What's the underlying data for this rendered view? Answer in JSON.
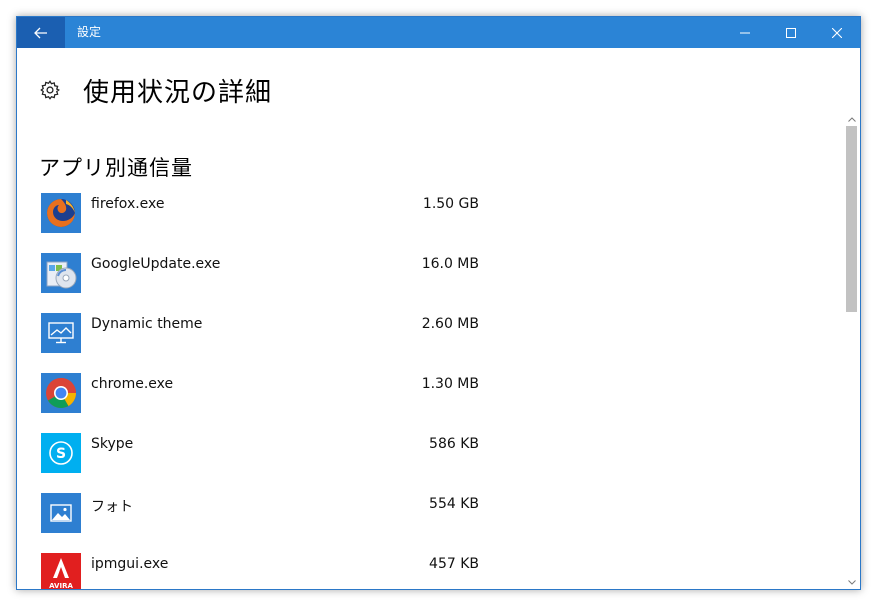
{
  "window": {
    "title": "設定",
    "accent": "#2b84d6",
    "back_button_color": "#1b5fb1"
  },
  "header": {
    "icon": "gear-icon",
    "title": "使用状況の詳細"
  },
  "section": {
    "title": "アプリ別通信量"
  },
  "apps": [
    {
      "name": "firefox.exe",
      "usage": "1.50 GB",
      "icon": "firefox-icon"
    },
    {
      "name": "GoogleUpdate.exe",
      "usage": "16.0 MB",
      "icon": "google-update-icon"
    },
    {
      "name": "Dynamic theme",
      "usage": "2.60 MB",
      "icon": "dynamic-theme-icon"
    },
    {
      "name": "chrome.exe",
      "usage": "1.30 MB",
      "icon": "chrome-icon"
    },
    {
      "name": "Skype",
      "usage": "586 KB",
      "icon": "skype-icon"
    },
    {
      "name": "フォト",
      "usage": "554 KB",
      "icon": "photos-icon"
    },
    {
      "name": "ipmgui.exe",
      "usage": "457 KB",
      "icon": "avira-icon",
      "icon_text": "AVIRA"
    }
  ]
}
